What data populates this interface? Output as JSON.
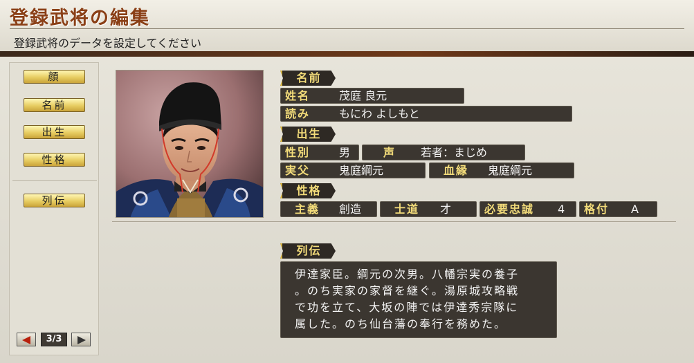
{
  "header": {
    "title": "登録武将の編集",
    "subtitle": "登録武将のデータを設定してください"
  },
  "menu": {
    "items": [
      {
        "label": "顔"
      },
      {
        "label": "名前"
      },
      {
        "label": "出生"
      },
      {
        "label": "性格"
      },
      {
        "label": "列伝"
      }
    ],
    "pager": "3/3"
  },
  "portrait": {
    "icon": "samurai-portrait"
  },
  "sections": {
    "name": "名前",
    "birth": "出生",
    "personality": "性格",
    "biography": "列伝"
  },
  "fields": {
    "full_name": {
      "label": "姓名",
      "value": "茂庭 良元"
    },
    "reading": {
      "label": "読み",
      "value": "もにわ よしもと"
    },
    "gender": {
      "label": "性別",
      "value": "男"
    },
    "voice": {
      "label": "声",
      "value": "若者：まじめ"
    },
    "father": {
      "label": "実父",
      "value": "鬼庭綱元"
    },
    "lineage": {
      "label": "血縁",
      "value": "鬼庭綱元"
    },
    "principle": {
      "label": "主義",
      "value": "創造"
    },
    "samurai_way": {
      "label": "士道",
      "value": "才"
    },
    "loyalty": {
      "label": "必要忠誠",
      "value": "4"
    },
    "rank": {
      "label": "格付",
      "value": "A"
    }
  },
  "biography": {
    "lines": [
      "伊達家臣。綱元の次男。八幡宗実の養子",
      "。のち実家の家督を継ぐ。湯原城攻略戦",
      "で功を立て、大坂の陣では伊達秀宗隊に",
      "属した。のち仙台藩の奉行を務めた。"
    ]
  },
  "colors": {
    "title": "#8a3f16",
    "label_gold": "#f3dc7a",
    "field_bg": "#3b3630",
    "button_gold": "#e7cd62"
  }
}
